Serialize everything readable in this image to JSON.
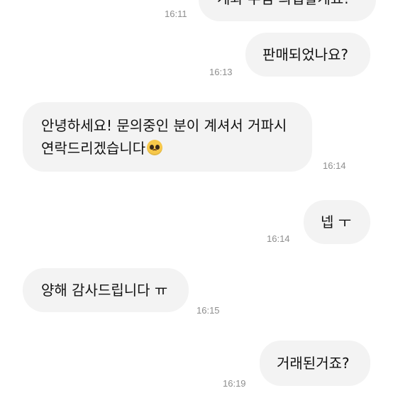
{
  "messages": [
    {
      "text": "계좌 주심 의입할게요!",
      "time": "16:11",
      "side": "sent"
    },
    {
      "text": "판매되었나요?",
      "time": "16:13",
      "side": "sent"
    },
    {
      "line1": "안녕하세요! 문의중인 분이 계셔서 거파시",
      "line2": "연락드리겠습니다",
      "emoji": "pleading-face-emoji",
      "time": "16:14",
      "side": "received"
    },
    {
      "text": "넵 ㅜ",
      "time": "16:14",
      "side": "sent"
    },
    {
      "text": "양해 감사드립니다 ㅠ",
      "time": "16:15",
      "side": "received"
    },
    {
      "text": "거래된거죠?",
      "time": "16:19",
      "side": "sent"
    }
  ],
  "colors": {
    "bubble": "#f3f3f3",
    "timestamp": "#8e8e8e",
    "text": "#111111"
  }
}
